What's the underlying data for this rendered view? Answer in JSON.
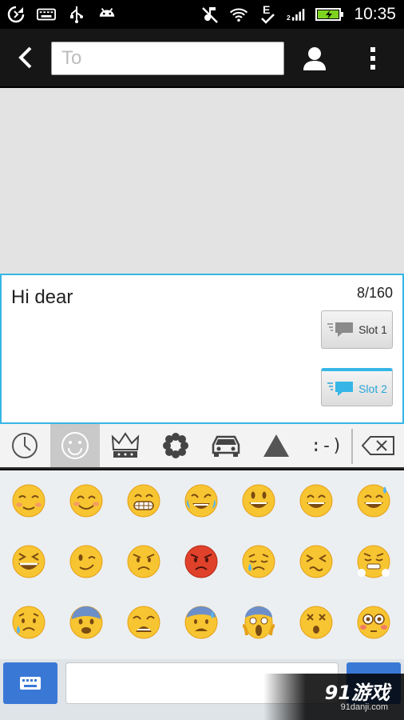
{
  "status_bar": {
    "time": "10:35",
    "left_icons": [
      "sync-icon",
      "keyboard-icon",
      "usb-icon",
      "android-icon"
    ],
    "right_icons": [
      "mute-icon",
      "wifi-icon",
      "edge-signal-icon",
      "cell-signal-icon",
      "battery-icon"
    ],
    "battery_color": "#7ed321"
  },
  "action_bar": {
    "to_placeholder": "To"
  },
  "compose": {
    "message_text": "Hi dear",
    "counter": "8/160",
    "slot1_label": "Slot 1",
    "slot2_label": "Slot 2",
    "accent": "#37b6e6"
  },
  "emoji_tabs": {
    "items": [
      "recent",
      "smileys",
      "objects",
      "nature",
      "places",
      "symbols",
      "emoticons"
    ],
    "emoticon_text": ":-)",
    "active": "smileys"
  },
  "emoji_grid": {
    "rows": [
      [
        "☺️",
        "😊",
        "😁",
        "😂",
        "😃",
        "😄",
        "😅"
      ],
      [
        "😆",
        "😉",
        "😠",
        "😡",
        "😢",
        "😣",
        "😤"
      ],
      [
        "😥",
        "😨",
        "😩",
        "😰",
        "😱",
        "😲",
        "😳"
      ]
    ]
  },
  "watermark": {
    "main": "91游戏",
    "sub": "91danji.com"
  }
}
